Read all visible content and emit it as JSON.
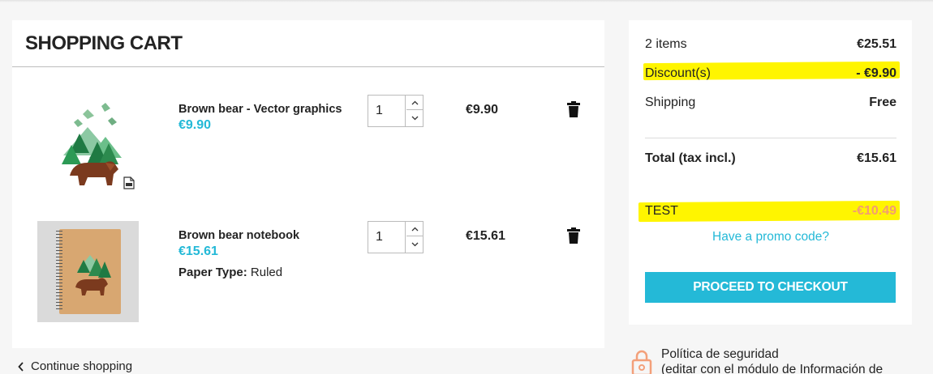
{
  "cart": {
    "title": "SHOPPING CART",
    "items": [
      {
        "name": "Brown bear - Vector graphics",
        "unit_price": "€9.90",
        "quantity": "1",
        "line_total": "€9.90"
      },
      {
        "name": "Brown bear notebook",
        "unit_price": "€15.61",
        "attribute_label": "Paper Type:",
        "attribute_value": "Ruled",
        "quantity": "1",
        "line_total": "€15.61"
      }
    ],
    "continue_label": "Continue shopping"
  },
  "summary": {
    "items_label": "2 items",
    "items_value": "€25.51",
    "discount_label": "Discount(s)",
    "discount_value": "- €9.90",
    "shipping_label": "Shipping",
    "shipping_value": "Free",
    "total_label": "Total (tax incl.)",
    "total_value": "€15.61",
    "voucher_label": "TEST",
    "voucher_value": "-€10.49",
    "promo_link": "Have a promo code?",
    "checkout_label": "PROCEED TO CHECKOUT"
  },
  "reassurance": {
    "line1": "Política de seguridad",
    "line2": "(editar con el módulo de Información de"
  },
  "colors": {
    "accent": "#24b9d7",
    "highlight": "#fff500",
    "voucher_value": "#f39d72"
  }
}
